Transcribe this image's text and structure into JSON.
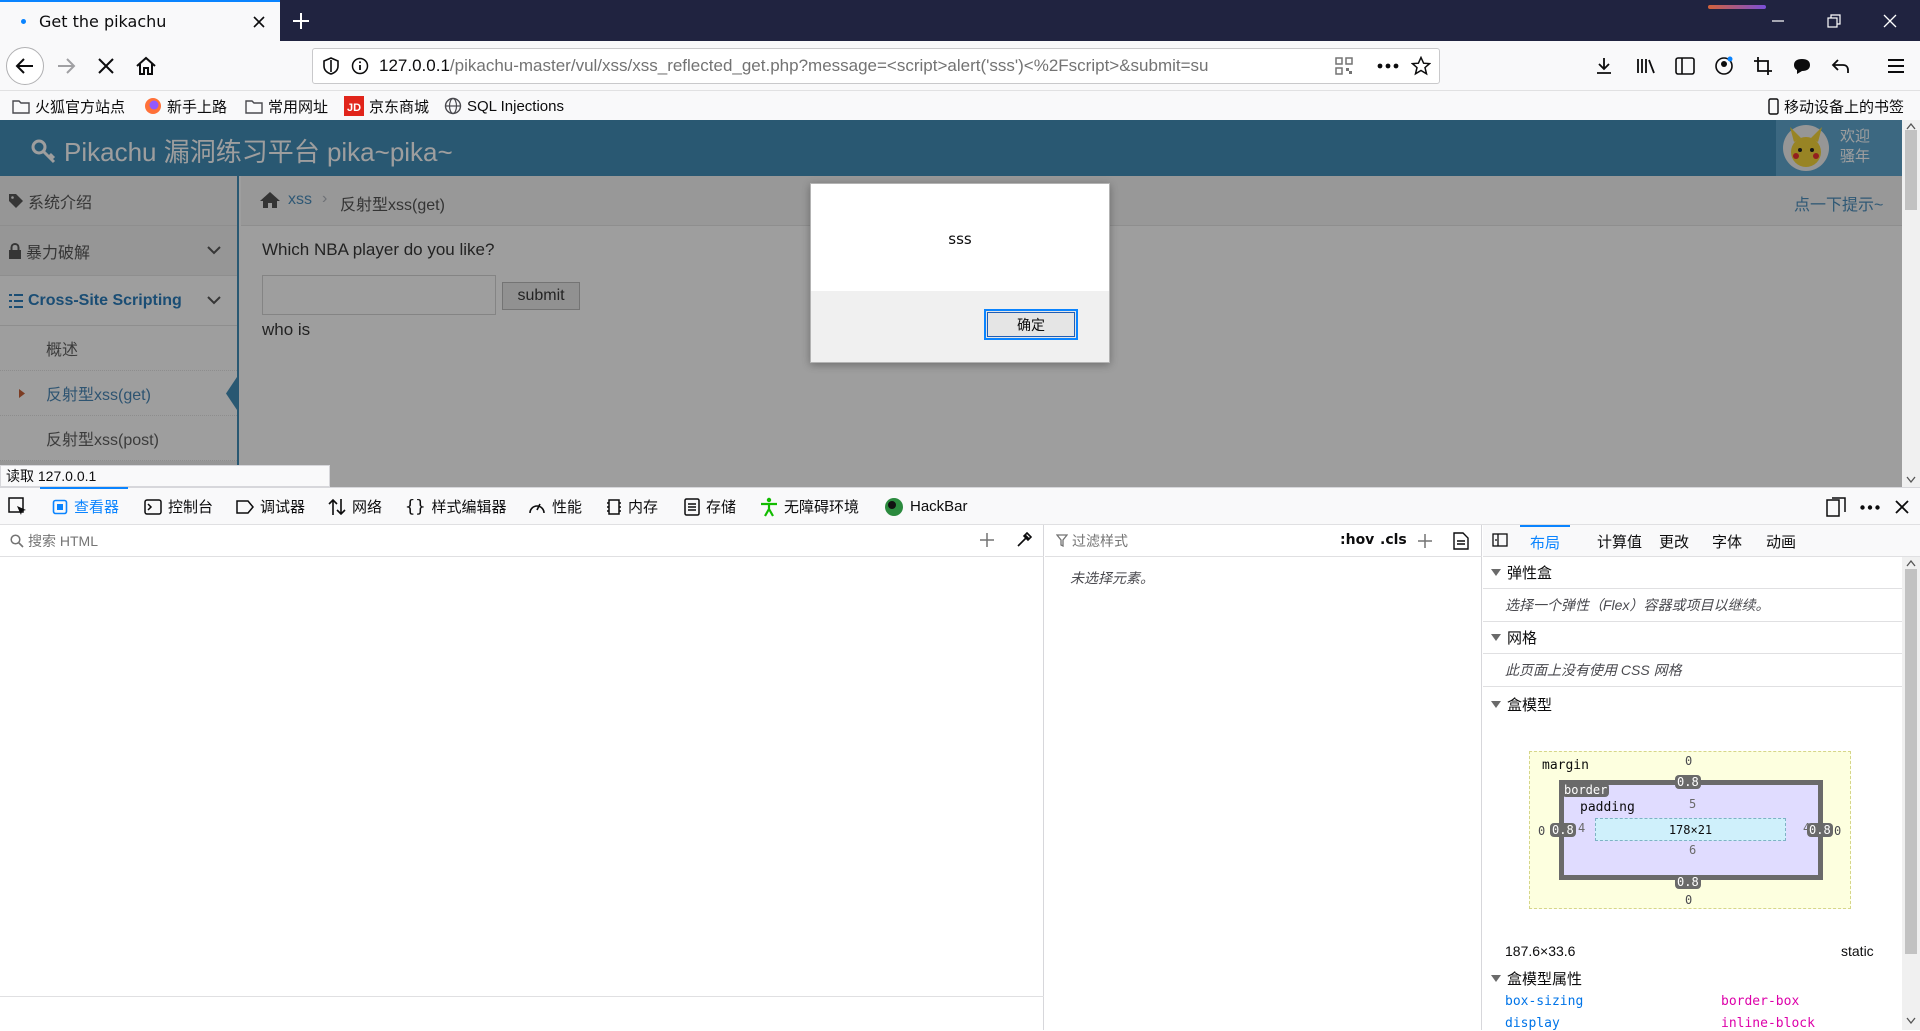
{
  "browser": {
    "tab_title": "Get the pikachu",
    "url_host": "127.0.0.1",
    "url_path": "/pikachu-master/vul/xss/xss_reflected_get.php?message=<script>alert('sss')<%2Fscript>&submit=su"
  },
  "bookmarks": [
    {
      "label": "火狐官方站点",
      "icon": "folder-icon"
    },
    {
      "label": "新手上路",
      "icon": "firefox-icon"
    },
    {
      "label": "常用网址",
      "icon": "folder-icon"
    },
    {
      "label": "京东商城",
      "icon": "jd-icon"
    },
    {
      "label": "SQL Injections",
      "icon": "globe-icon"
    }
  ],
  "mobile_bookmarks": "移动设备上的书签",
  "page": {
    "brand": "Pikachu 漏洞练习平台 pika~pika~",
    "user_lines": [
      "欢迎",
      "骚年"
    ],
    "sidebar": [
      {
        "label": "系统介绍",
        "icon": "tag-icon"
      },
      {
        "label": "暴力破解",
        "icon": "lock-icon"
      },
      {
        "label": "Cross-Site Scripting",
        "icon": "list-icon"
      }
    ],
    "sidebar_sub": [
      "概述",
      "反射型xss(get)",
      "反射型xss(post)"
    ],
    "breadcrumb": [
      "xss",
      "反射型xss(get)"
    ],
    "hint": "点一下提示~",
    "question": "Which NBA player do you like?",
    "submit_label": "submit",
    "result": "who is"
  },
  "alert": {
    "message": "sss",
    "ok_label": "确定"
  },
  "status_text": "读取 127.0.0.1",
  "devtools": {
    "tabs": [
      {
        "label": "查看器",
        "icon": "inspector-icon"
      },
      {
        "label": "控制台",
        "icon": "console-icon"
      },
      {
        "label": "调试器",
        "icon": "debugger-icon"
      },
      {
        "label": "网络",
        "icon": "network-icon"
      },
      {
        "label": "样式编辑器",
        "icon": "style-editor-icon"
      },
      {
        "label": "性能",
        "icon": "performance-icon"
      },
      {
        "label": "内存",
        "icon": "memory-icon"
      },
      {
        "label": "存储",
        "icon": "storage-icon"
      },
      {
        "label": "无障碍环境",
        "icon": "accessibility-icon"
      },
      {
        "label": "HackBar",
        "icon": "hackbar-icon"
      }
    ],
    "search_html_placeholder": "搜索 HTML",
    "filter_styles_placeholder": "过滤样式",
    "hov": ":hov",
    "cls": ".cls",
    "no_element": "未选择元素。",
    "side_tabs": [
      "布局",
      "计算值",
      "更改",
      "字体",
      "动画"
    ],
    "flex_title": "弹性盒",
    "flex_msg": "选择一个弹性（Flex）容器或项目以继续。",
    "grid_title": "网格",
    "grid_msg": "此页面上没有使用 CSS 网格",
    "box_title": "盒模型",
    "box": {
      "margin_label": "margin",
      "border_label": "border",
      "padding_label": "padding",
      "margin_top": "0",
      "margin_bottom": "0",
      "margin_left": "0",
      "margin_right": "0",
      "border_top": "0.8",
      "border_bottom": "0.8",
      "border_left": "0.8",
      "border_right": "0.8",
      "padding_top": "5",
      "padding_bottom": "6",
      "padding_left": "4",
      "padding_right": "4",
      "content": "178×21"
    },
    "size": "187.6×33.6",
    "position": "static",
    "box_props_title": "盒模型属性",
    "props": [
      {
        "name": "box-sizing",
        "value": "border-box"
      },
      {
        "name": "display",
        "value": "inline-block"
      }
    ]
  }
}
